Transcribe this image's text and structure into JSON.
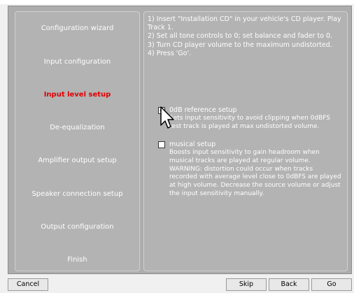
{
  "nav": {
    "items": [
      {
        "label": "Configuration wizard"
      },
      {
        "label": "Input configuration"
      },
      {
        "label": "Input level setup"
      },
      {
        "label": "De-equalization"
      },
      {
        "label": "Amplifier output setup"
      },
      {
        "label": "Speaker connection setup"
      },
      {
        "label": "Output configuration"
      },
      {
        "label": "Finish"
      }
    ],
    "active_label": "Input level setup",
    "active_color": "#e00000"
  },
  "instructions": {
    "lines": [
      "1) Insert \"Installation CD\" in your vehicle's CD player. Play Track 1.",
      "2) Set all tone controls to 0; set balance and fader to 0.",
      "3) Turn CD player volume to the maximum undistorted.",
      "4) Press 'Go'."
    ]
  },
  "options": [
    {
      "title": "0dB reference setup",
      "checked": true,
      "description": "Sets input sensitivity to avoid clipping when 0dBFS\ntest track is played at max undistorted volume."
    },
    {
      "title": "musical setup",
      "checked": false,
      "description": "Boosts input sensitivity to gain headroom when\nmusical tracks are played at regular volume.\nWARNING: distortion could occur when tracks\nrecorded with average level close to 0dBFS are played\nat high volume. Decrease the source volume or adjust\nthe input sensitivity manually."
    }
  ],
  "buttons": {
    "cancel": "Cancel",
    "skip": "Skip",
    "back": "Back",
    "go": "Go"
  }
}
